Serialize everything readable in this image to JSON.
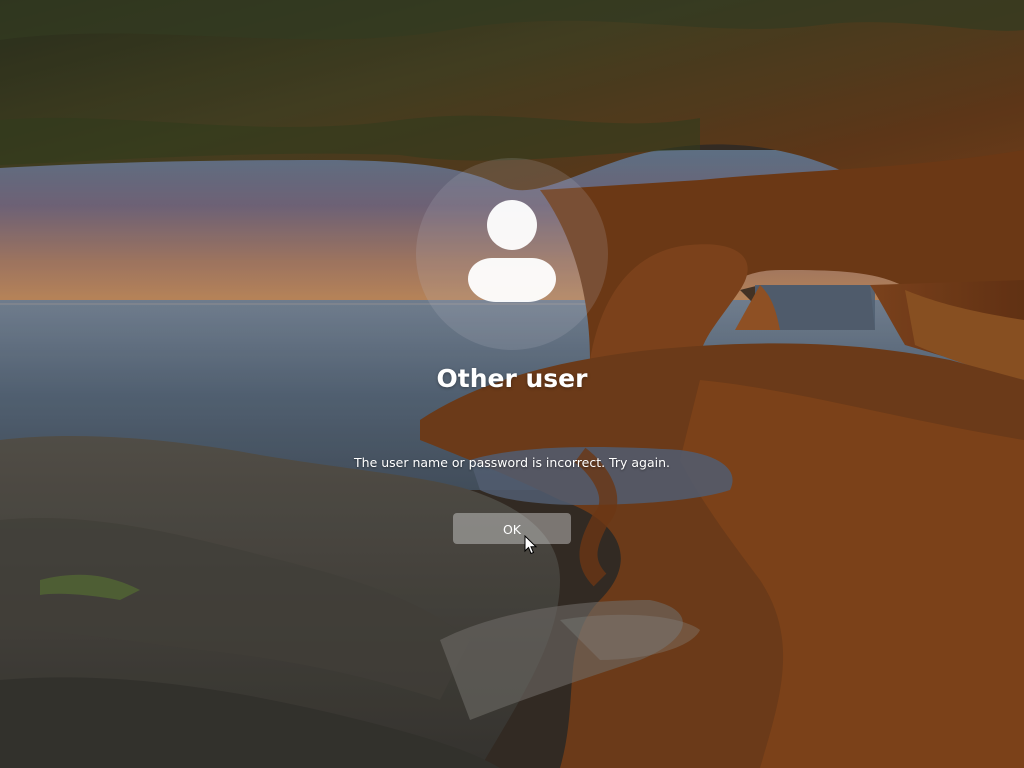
{
  "login": {
    "user_name": "Other user",
    "error_message": "The user name or password is incorrect. Try again.",
    "ok_label": "OK"
  },
  "icons": {
    "avatar": "user-avatar-icon",
    "cursor": "mouse-pointer-icon"
  },
  "colors": {
    "text": "#ffffff",
    "avatar_glyph": "#ffffff",
    "button_background": "rgba(225,225,225,0.42)"
  }
}
